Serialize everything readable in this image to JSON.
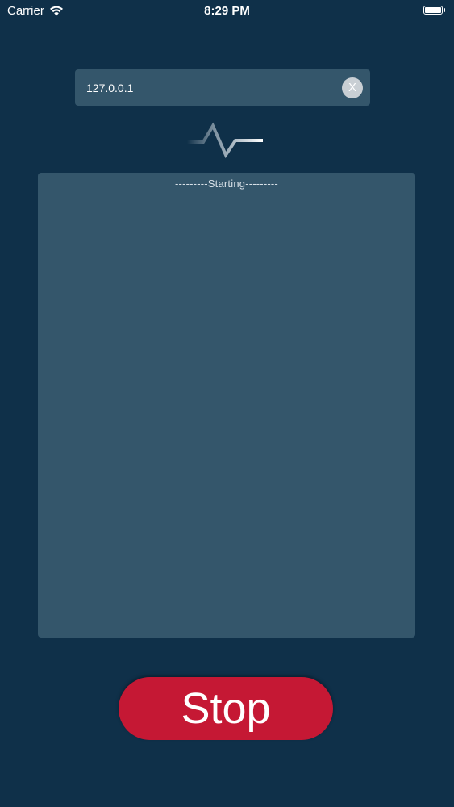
{
  "status_bar": {
    "carrier": "Carrier",
    "time": "8:29 PM"
  },
  "host_input": {
    "value": "127.0.0.1",
    "clear_label": "X"
  },
  "log": {
    "lines": [
      "---------Starting---------"
    ]
  },
  "stop_button": {
    "label": "Stop"
  },
  "colors": {
    "background": "#0f3049",
    "panel": "#34566b",
    "stop": "#c51834"
  },
  "icons": {
    "pulse": "activity-pulse-icon",
    "wifi": "wifi-icon",
    "battery": "battery-icon"
  }
}
